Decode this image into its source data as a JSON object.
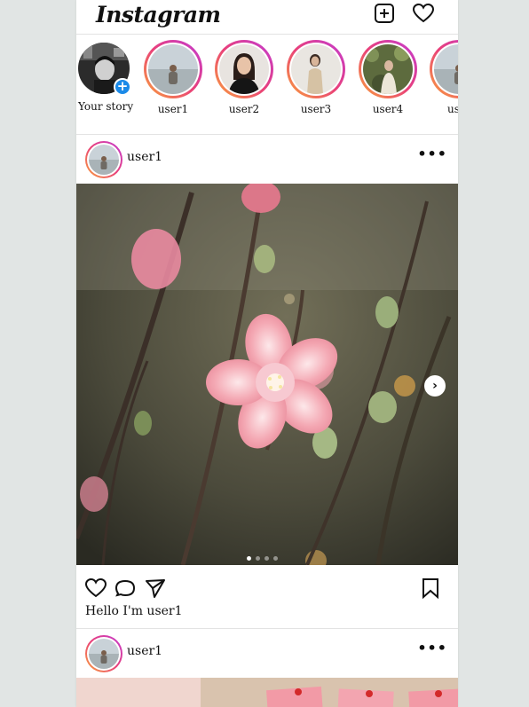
{
  "app": {
    "logo": "Instagram"
  },
  "header": {
    "new_post_icon": "plus-square-icon",
    "activity_icon": "heart-icon"
  },
  "stories": {
    "own": {
      "label": "Your story",
      "badge": "+"
    },
    "items": [
      {
        "label": "user1"
      },
      {
        "label": "user2"
      },
      {
        "label": "user3"
      },
      {
        "label": "user4"
      },
      {
        "label": "us"
      }
    ]
  },
  "posts": [
    {
      "username": "user1",
      "more": "•••",
      "caption": "Hello I'm user1",
      "carousel": {
        "next": "›",
        "slides": 4,
        "current": 1
      }
    },
    {
      "username": "user1",
      "more": "•••"
    }
  ],
  "colors": {
    "story_ring_start": "#f9a33a",
    "story_ring_mid": "#e9407a",
    "story_ring_end": "#c23bd4",
    "badge": "#1b8ae8"
  }
}
